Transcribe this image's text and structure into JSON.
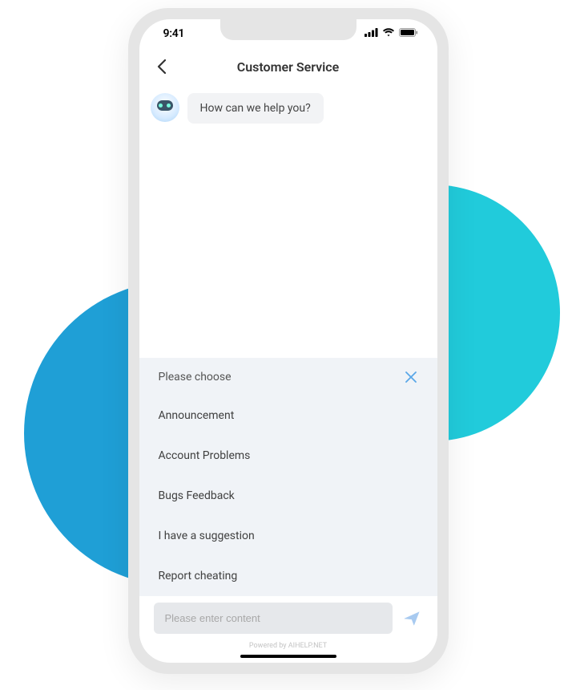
{
  "status": {
    "time": "9:41"
  },
  "nav": {
    "title": "Customer Service"
  },
  "chat": {
    "bot_message": "How can we help you?"
  },
  "menu": {
    "header": "Please choose",
    "items": [
      {
        "label": "Announcement"
      },
      {
        "label": "Account Problems"
      },
      {
        "label": "Bugs Feedback"
      },
      {
        "label": "I have a suggestion"
      },
      {
        "label": "Report cheating"
      }
    ]
  },
  "input": {
    "placeholder": "Please enter content"
  },
  "footer": {
    "powered_by": "Powered by AIHELP.NET"
  }
}
